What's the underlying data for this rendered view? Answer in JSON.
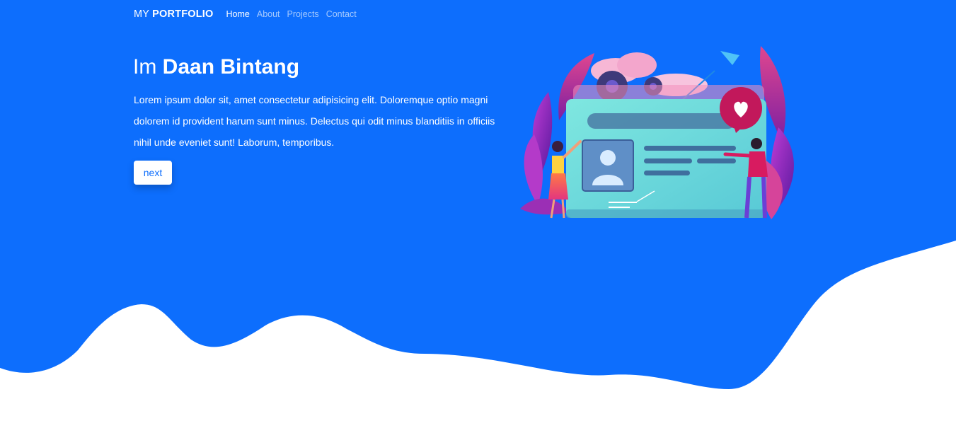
{
  "navbar": {
    "brand_prefix": "MY",
    "brand_strong": "PORTFOLIO",
    "links": [
      {
        "label": "Home",
        "active": true
      },
      {
        "label": "About",
        "active": false
      },
      {
        "label": "Projects",
        "active": false
      },
      {
        "label": "Contact",
        "active": false
      }
    ]
  },
  "hero": {
    "title_prefix": "Im",
    "title_name": "Daan Bintang",
    "description": "Lorem ipsum dolor sit, amet consectetur adipisicing elit. Doloremque optio magni dolorem id provident harum sunt minus. Delectus qui odit minus blanditiis in officiis nihil unde eveniet sunt! Laborum, temporibus.",
    "button_label": "next"
  },
  "colors": {
    "primary": "#0d6efd",
    "background": "#ffffff",
    "card": "#6fe3dc",
    "accent_pink": "#d63384",
    "accent_purple": "#8a2be2"
  },
  "icons": {
    "illustration": "profile-card-illustration",
    "gear": "gear-icon",
    "heart": "heart-icon",
    "paper_plane": "paper-plane-icon",
    "avatar": "user-avatar-icon"
  }
}
